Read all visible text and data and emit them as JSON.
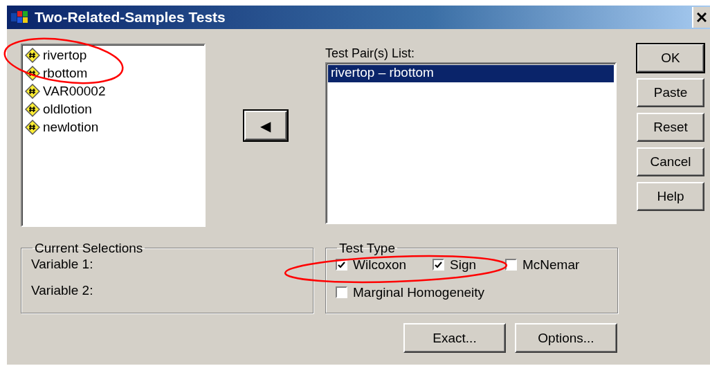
{
  "window": {
    "title": "Two-Related-Samples Tests"
  },
  "variables": [
    {
      "name": "rivertop"
    },
    {
      "name": "rbottom"
    },
    {
      "name": "VAR00002"
    },
    {
      "name": "oldlotion"
    },
    {
      "name": "newlotion"
    }
  ],
  "move_button": {
    "label": "◀"
  },
  "test_pairs": {
    "label": "Test Pair(s) List:",
    "items": [
      {
        "text": "rivertop – rbottom",
        "selected": true
      }
    ]
  },
  "current_selections": {
    "title": "Current Selections",
    "fields": [
      "Variable 1:",
      "Variable 2:"
    ]
  },
  "test_type": {
    "title": "Test Type",
    "options": [
      {
        "label": "Wilcoxon",
        "checked": true
      },
      {
        "label": "Sign",
        "checked": true
      },
      {
        "label": "McNemar",
        "checked": false
      },
      {
        "label": "Marginal Homogeneity",
        "checked": false
      }
    ]
  },
  "side_buttons": [
    {
      "label": "OK",
      "default": true
    },
    {
      "label": "Paste",
      "default": false
    },
    {
      "label": "Reset",
      "default": false
    },
    {
      "label": "Cancel",
      "default": false
    },
    {
      "label": "Help",
      "default": false
    }
  ],
  "bottom_buttons": [
    "Exact...",
    "Options..."
  ],
  "annotations": [
    {
      "kind": "ellipse"
    },
    {
      "kind": "ellipse"
    }
  ]
}
